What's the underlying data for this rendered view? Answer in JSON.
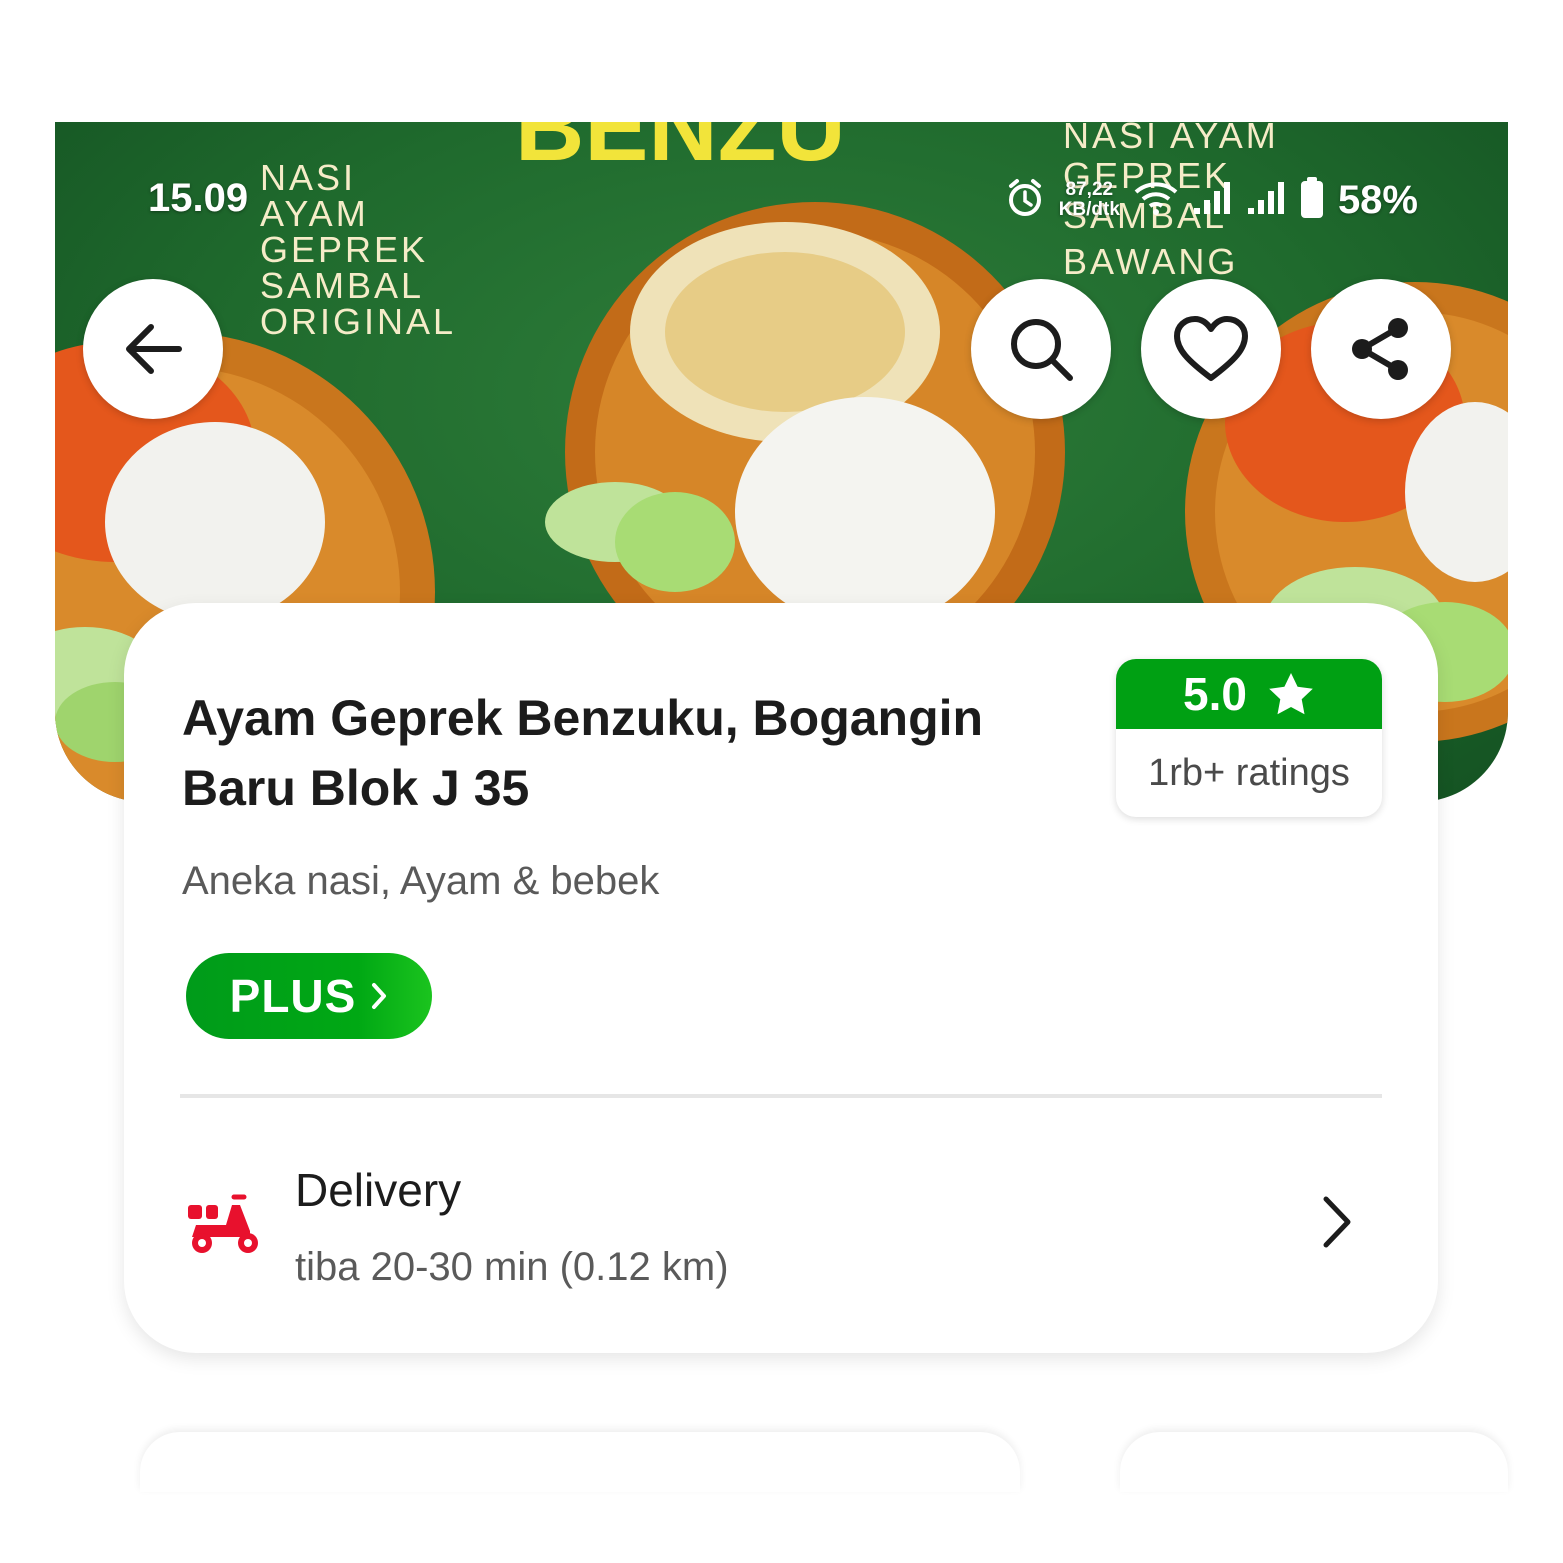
{
  "status_bar": {
    "time": "15.09",
    "net_speed_value": "87,22",
    "net_speed_unit": "KB/dtk",
    "battery": "58%"
  },
  "hero": {
    "brand_text": "BENZU",
    "left_text": [
      "NASI",
      "AYAM",
      "GEPREK",
      "SAMBAL",
      "ORIGINAL"
    ],
    "right_text": [
      "NASI AYAM",
      "GEPREK",
      "SAMBAL",
      "BAWANG"
    ]
  },
  "restaurant": {
    "name_line1": "Ayam Geprek Benzuku, Bogangin",
    "name_line2": "Baru Blok J 35",
    "cuisine": "Aneka nasi, Ayam & bebek",
    "rating": "5.0",
    "ratings_count": "1rb+ ratings",
    "plus_label": "PLUS"
  },
  "delivery": {
    "title": "Delivery",
    "subtitle": "tiba 20-30 min (0.12 km)"
  },
  "colors": {
    "brand_green": "#00a013",
    "delivery_red": "#e8112d"
  }
}
